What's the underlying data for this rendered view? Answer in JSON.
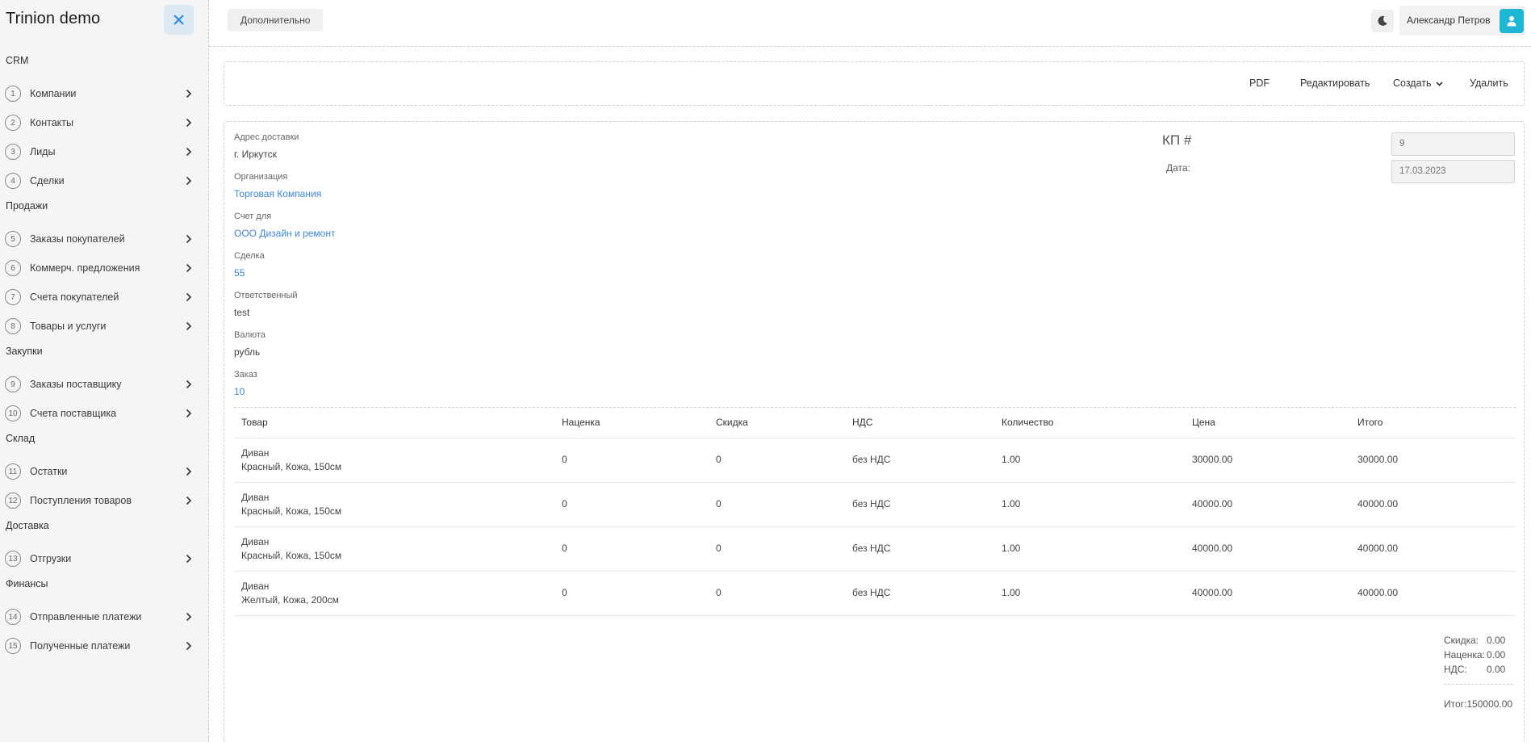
{
  "app": {
    "title": "Trinion demo"
  },
  "sidebar": {
    "groups": [
      {
        "label": "CRM",
        "items": [
          {
            "num": "1",
            "label": "Компании"
          },
          {
            "num": "2",
            "label": "Контакты"
          },
          {
            "num": "3",
            "label": "Лиды"
          },
          {
            "num": "4",
            "label": "Сделки"
          }
        ]
      },
      {
        "label": "Продажи",
        "items": [
          {
            "num": "5",
            "label": "Заказы покупателей"
          },
          {
            "num": "6",
            "label": "Коммерч. предложения"
          },
          {
            "num": "7",
            "label": "Счета покупателей"
          },
          {
            "num": "8",
            "label": "Товары и услуги"
          }
        ]
      },
      {
        "label": "Закупки",
        "items": [
          {
            "num": "9",
            "label": "Заказы поставщику"
          },
          {
            "num": "10",
            "label": "Счета поставщика"
          }
        ]
      },
      {
        "label": "Склад",
        "items": [
          {
            "num": "11",
            "label": "Остатки"
          },
          {
            "num": "12",
            "label": "Поступления товаров"
          }
        ]
      },
      {
        "label": "Доставка",
        "items": [
          {
            "num": "13",
            "label": "Отгрузки"
          }
        ]
      },
      {
        "label": "Финансы",
        "items": [
          {
            "num": "14",
            "label": "Отправленные платежи"
          },
          {
            "num": "15",
            "label": "Полученные платежи"
          }
        ]
      }
    ]
  },
  "topbar": {
    "more_label": "Дополнительно",
    "user_name": "Александр Петров",
    "theme_icon": "moon-icon",
    "avatar_icon": "user-icon"
  },
  "toolbar": {
    "pdf": "PDF",
    "edit": "Редактировать",
    "create": "Создать",
    "delete": "Удалить"
  },
  "document": {
    "fields": [
      {
        "label": "Адрес доставки",
        "value": "г. Иркутск",
        "link": false
      },
      {
        "label": "Организация",
        "value": "Торговая Компания",
        "link": true
      },
      {
        "label": "Счет для",
        "value": "ООО Дизайн и ремонт",
        "link": true
      },
      {
        "label": "Сделка",
        "value": "55",
        "link": true
      },
      {
        "label": "Ответственный",
        "value": "test",
        "link": false
      },
      {
        "label": "Валюта",
        "value": "рубль",
        "link": false
      },
      {
        "label": "Заказ",
        "value": "10",
        "link": true
      }
    ],
    "kp_label": "КП #",
    "kp_number": "9",
    "date_label": "Дата:",
    "date_value": "17.03.2023"
  },
  "table": {
    "columns": [
      "Товар",
      "Наценка",
      "Скидка",
      "НДС",
      "Количество",
      "Цена",
      "Итого"
    ],
    "rows": [
      {
        "name": "Диван",
        "desc": "Красный, Кожа, 150см",
        "markup": "0",
        "discount": "0",
        "vat": "без НДС",
        "qty": "1.00",
        "price": "30000.00",
        "total": "30000.00"
      },
      {
        "name": "Диван",
        "desc": "Красный, Кожа, 150см",
        "markup": "0",
        "discount": "0",
        "vat": "без НДС",
        "qty": "1.00",
        "price": "40000.00",
        "total": "40000.00"
      },
      {
        "name": "Диван",
        "desc": "Красный, Кожа, 150см",
        "markup": "0",
        "discount": "0",
        "vat": "без НДС",
        "qty": "1.00",
        "price": "40000.00",
        "total": "40000.00"
      },
      {
        "name": "Диван",
        "desc": "Желтый, Кожа, 200см",
        "markup": "0",
        "discount": "0",
        "vat": "без НДС",
        "qty": "1.00",
        "price": "40000.00",
        "total": "40000.00"
      }
    ]
  },
  "totals": {
    "discount_label": "Скидка:",
    "discount_value": "0.00",
    "markup_label": "Наценка:",
    "markup_value": "0.00",
    "vat_label": "НДС:",
    "vat_value": "0.00",
    "grand_label": "Итог:",
    "grand_value": "150000.00"
  }
}
